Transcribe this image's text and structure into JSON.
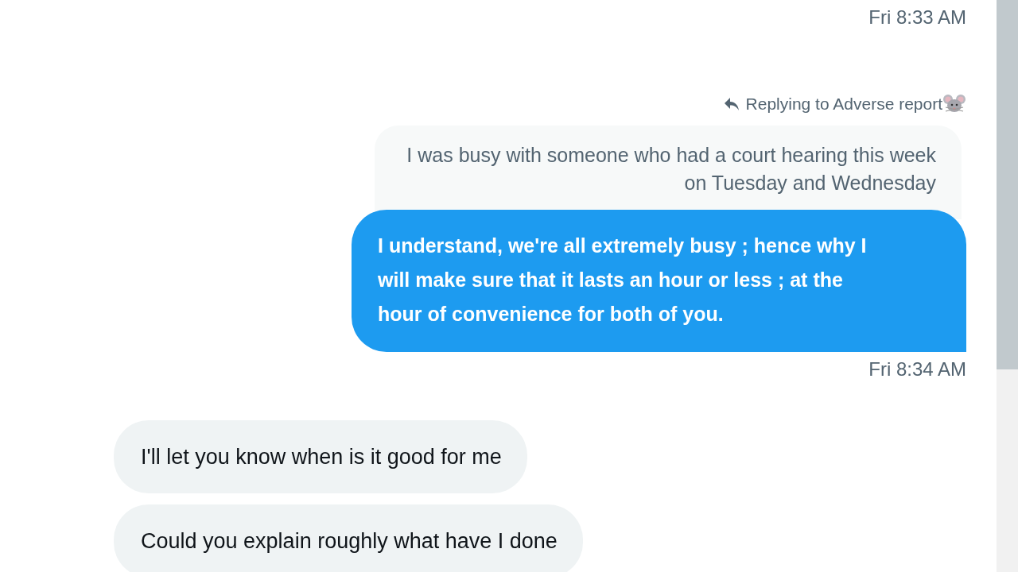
{
  "messages": [
    {
      "kind": "timestamp",
      "text": "Fri 8:33 AM"
    },
    {
      "kind": "reply_context",
      "text": "Replying to Adverse report"
    },
    {
      "kind": "quoted",
      "lines": [
        "I was busy with someone who had a court hearing this week",
        "on Tuesday and Wednesday"
      ]
    },
    {
      "kind": "sent",
      "lines": [
        "I understand, we're all extremely busy ; hence why I",
        "will make sure that it lasts an hour or less ; at the",
        "hour of convenience for both of you."
      ]
    },
    {
      "kind": "timestamp",
      "text": "Fri 8:34 AM"
    },
    {
      "kind": "received",
      "lines": [
        "I'll let you know when is it good for me"
      ]
    },
    {
      "kind": "received",
      "lines": [
        "Could you explain roughly what have I done"
      ]
    }
  ]
}
